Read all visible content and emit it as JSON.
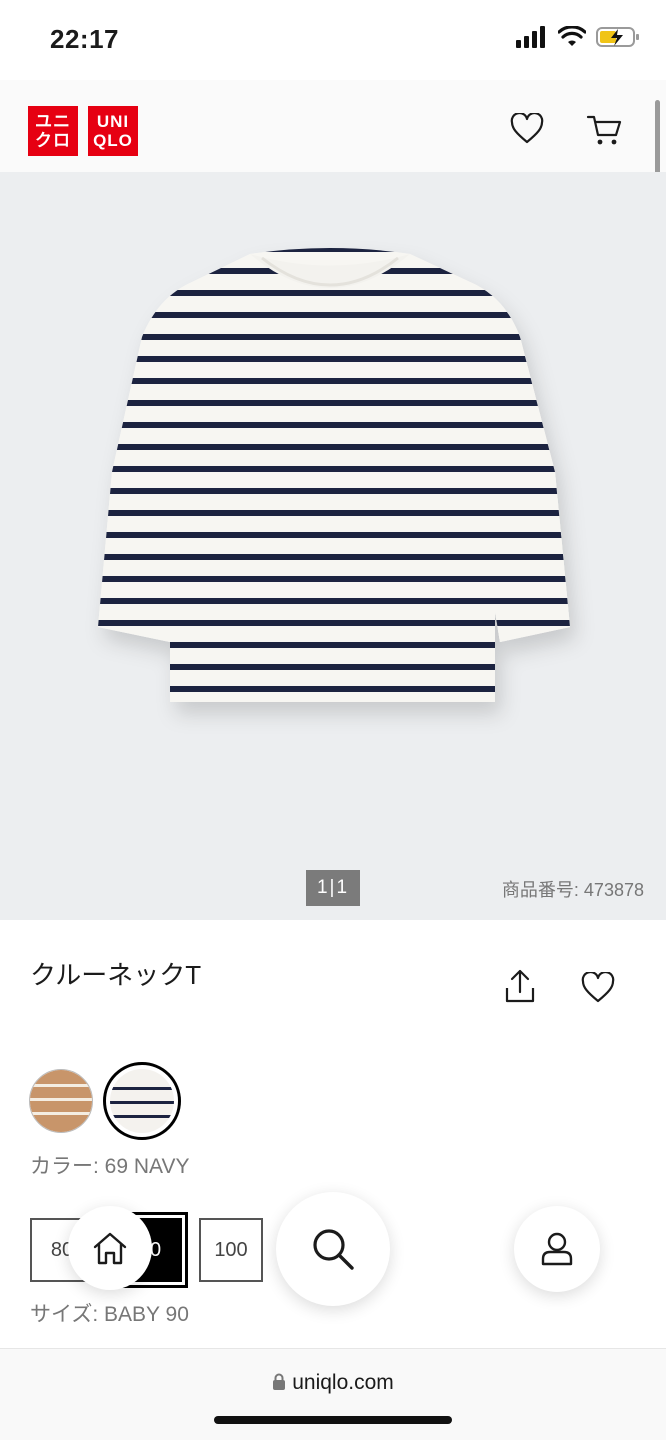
{
  "status_bar": {
    "time": "22:17"
  },
  "header": {
    "logo": {
      "left_top": "ユニ",
      "left_bottom": "クロ",
      "right_top": "UNI",
      "right_bottom": "QLO"
    },
    "icons": [
      "heart-icon",
      "cart-icon"
    ]
  },
  "gallery": {
    "pager": "1|1",
    "product_number": "商品番号: 473878"
  },
  "product": {
    "title": "クルーネックT"
  },
  "colors": {
    "label": "カラー: 69 NAVY",
    "options": [
      "beige-stripe",
      "navy-stripe"
    ],
    "selected": "navy-stripe"
  },
  "sizes": {
    "label": "サイズ: BABY 90",
    "options": [
      "80",
      "90",
      "100"
    ],
    "selected": "90"
  },
  "bottom_nav": {
    "icons": [
      "home-icon",
      "search-icon",
      "user-icon"
    ]
  },
  "browser": {
    "url": "uniqlo.com"
  },
  "colors_theme": {
    "brand": "#e60012",
    "navy": "#1c2340",
    "beige": "#c8956a"
  }
}
